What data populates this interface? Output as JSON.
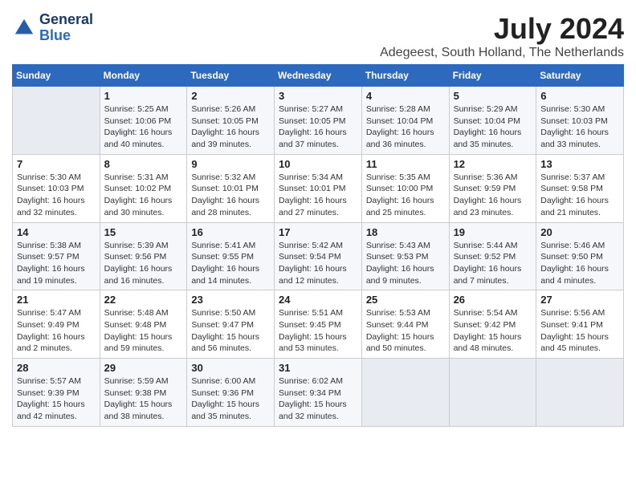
{
  "header": {
    "logo_line1": "General",
    "logo_line2": "Blue",
    "month_year": "July 2024",
    "location": "Adegeest, South Holland, The Netherlands"
  },
  "days_of_week": [
    "Sunday",
    "Monday",
    "Tuesday",
    "Wednesday",
    "Thursday",
    "Friday",
    "Saturday"
  ],
  "weeks": [
    [
      {
        "day": "",
        "info": ""
      },
      {
        "day": "1",
        "info": "Sunrise: 5:25 AM\nSunset: 10:06 PM\nDaylight: 16 hours\nand 40 minutes."
      },
      {
        "day": "2",
        "info": "Sunrise: 5:26 AM\nSunset: 10:05 PM\nDaylight: 16 hours\nand 39 minutes."
      },
      {
        "day": "3",
        "info": "Sunrise: 5:27 AM\nSunset: 10:05 PM\nDaylight: 16 hours\nand 37 minutes."
      },
      {
        "day": "4",
        "info": "Sunrise: 5:28 AM\nSunset: 10:04 PM\nDaylight: 16 hours\nand 36 minutes."
      },
      {
        "day": "5",
        "info": "Sunrise: 5:29 AM\nSunset: 10:04 PM\nDaylight: 16 hours\nand 35 minutes."
      },
      {
        "day": "6",
        "info": "Sunrise: 5:30 AM\nSunset: 10:03 PM\nDaylight: 16 hours\nand 33 minutes."
      }
    ],
    [
      {
        "day": "7",
        "info": "Sunrise: 5:30 AM\nSunset: 10:03 PM\nDaylight: 16 hours\nand 32 minutes."
      },
      {
        "day": "8",
        "info": "Sunrise: 5:31 AM\nSunset: 10:02 PM\nDaylight: 16 hours\nand 30 minutes."
      },
      {
        "day": "9",
        "info": "Sunrise: 5:32 AM\nSunset: 10:01 PM\nDaylight: 16 hours\nand 28 minutes."
      },
      {
        "day": "10",
        "info": "Sunrise: 5:34 AM\nSunset: 10:01 PM\nDaylight: 16 hours\nand 27 minutes."
      },
      {
        "day": "11",
        "info": "Sunrise: 5:35 AM\nSunset: 10:00 PM\nDaylight: 16 hours\nand 25 minutes."
      },
      {
        "day": "12",
        "info": "Sunrise: 5:36 AM\nSunset: 9:59 PM\nDaylight: 16 hours\nand 23 minutes."
      },
      {
        "day": "13",
        "info": "Sunrise: 5:37 AM\nSunset: 9:58 PM\nDaylight: 16 hours\nand 21 minutes."
      }
    ],
    [
      {
        "day": "14",
        "info": "Sunrise: 5:38 AM\nSunset: 9:57 PM\nDaylight: 16 hours\nand 19 minutes."
      },
      {
        "day": "15",
        "info": "Sunrise: 5:39 AM\nSunset: 9:56 PM\nDaylight: 16 hours\nand 16 minutes."
      },
      {
        "day": "16",
        "info": "Sunrise: 5:41 AM\nSunset: 9:55 PM\nDaylight: 16 hours\nand 14 minutes."
      },
      {
        "day": "17",
        "info": "Sunrise: 5:42 AM\nSunset: 9:54 PM\nDaylight: 16 hours\nand 12 minutes."
      },
      {
        "day": "18",
        "info": "Sunrise: 5:43 AM\nSunset: 9:53 PM\nDaylight: 16 hours\nand 9 minutes."
      },
      {
        "day": "19",
        "info": "Sunrise: 5:44 AM\nSunset: 9:52 PM\nDaylight: 16 hours\nand 7 minutes."
      },
      {
        "day": "20",
        "info": "Sunrise: 5:46 AM\nSunset: 9:50 PM\nDaylight: 16 hours\nand 4 minutes."
      }
    ],
    [
      {
        "day": "21",
        "info": "Sunrise: 5:47 AM\nSunset: 9:49 PM\nDaylight: 16 hours\nand 2 minutes."
      },
      {
        "day": "22",
        "info": "Sunrise: 5:48 AM\nSunset: 9:48 PM\nDaylight: 15 hours\nand 59 minutes."
      },
      {
        "day": "23",
        "info": "Sunrise: 5:50 AM\nSunset: 9:47 PM\nDaylight: 15 hours\nand 56 minutes."
      },
      {
        "day": "24",
        "info": "Sunrise: 5:51 AM\nSunset: 9:45 PM\nDaylight: 15 hours\nand 53 minutes."
      },
      {
        "day": "25",
        "info": "Sunrise: 5:53 AM\nSunset: 9:44 PM\nDaylight: 15 hours\nand 50 minutes."
      },
      {
        "day": "26",
        "info": "Sunrise: 5:54 AM\nSunset: 9:42 PM\nDaylight: 15 hours\nand 48 minutes."
      },
      {
        "day": "27",
        "info": "Sunrise: 5:56 AM\nSunset: 9:41 PM\nDaylight: 15 hours\nand 45 minutes."
      }
    ],
    [
      {
        "day": "28",
        "info": "Sunrise: 5:57 AM\nSunset: 9:39 PM\nDaylight: 15 hours\nand 42 minutes."
      },
      {
        "day": "29",
        "info": "Sunrise: 5:59 AM\nSunset: 9:38 PM\nDaylight: 15 hours\nand 38 minutes."
      },
      {
        "day": "30",
        "info": "Sunrise: 6:00 AM\nSunset: 9:36 PM\nDaylight: 15 hours\nand 35 minutes."
      },
      {
        "day": "31",
        "info": "Sunrise: 6:02 AM\nSunset: 9:34 PM\nDaylight: 15 hours\nand 32 minutes."
      },
      {
        "day": "",
        "info": ""
      },
      {
        "day": "",
        "info": ""
      },
      {
        "day": "",
        "info": ""
      }
    ]
  ]
}
